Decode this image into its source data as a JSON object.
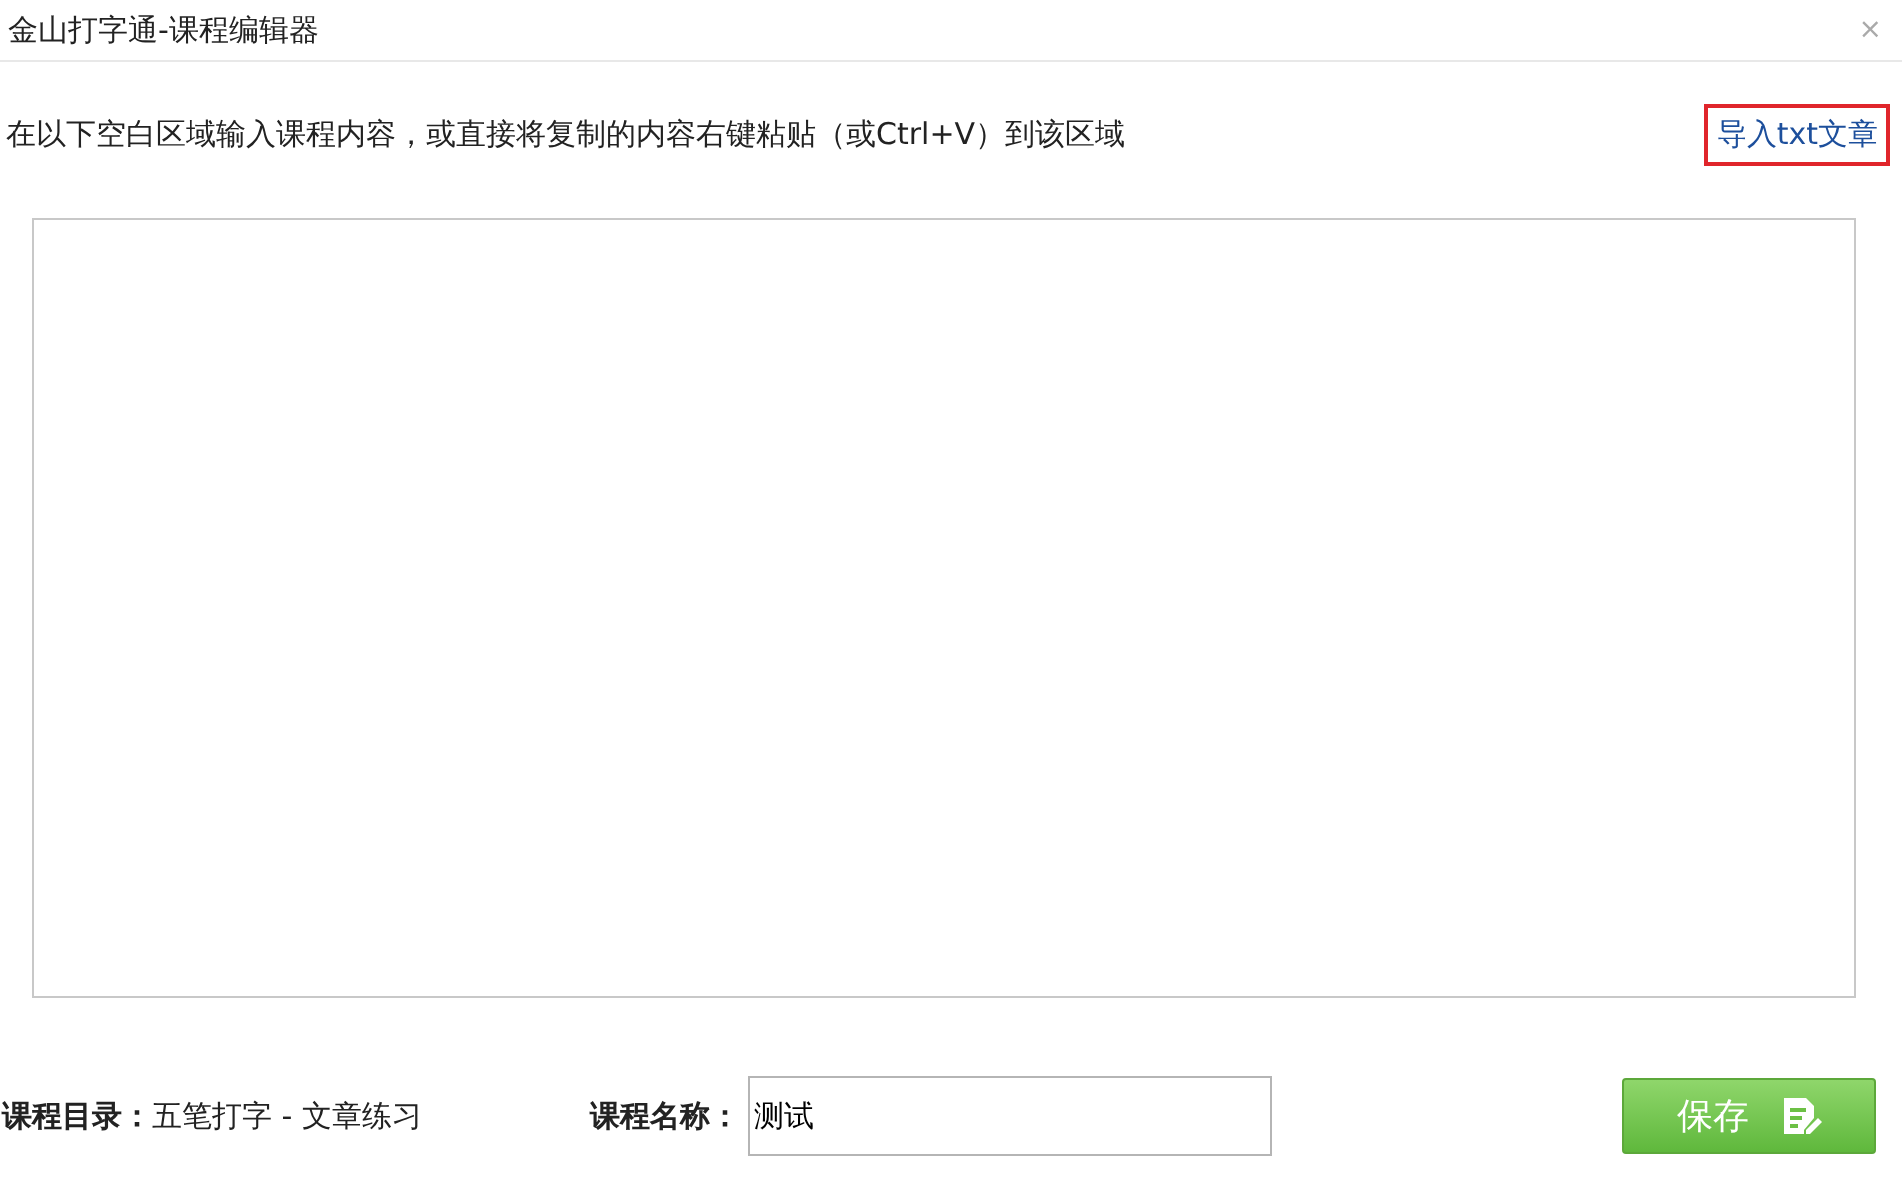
{
  "window": {
    "title": "金山打字通-课程编辑器",
    "close": "×"
  },
  "instruction": "在以下空白区域输入课程内容，或直接将复制的内容右键粘贴（或Ctrl+V）到该区域",
  "import_link": {
    "label": "导入txt文章",
    "highlighted": true
  },
  "catalog": {
    "label": "课程目录：",
    "value": "五笔打字 - 文章练习"
  },
  "course_name": {
    "label": "课程名称：",
    "value": "测试"
  },
  "save_button": {
    "label": "保存"
  }
}
